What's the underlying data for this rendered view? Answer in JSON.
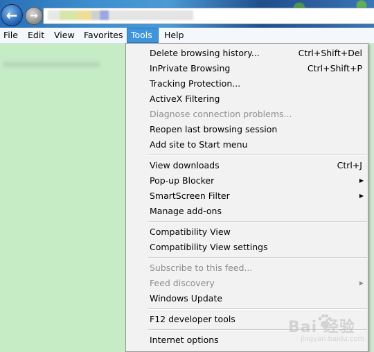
{
  "menubar": {
    "items": [
      "File",
      "Edit",
      "View",
      "Favorites",
      "Tools",
      "Help"
    ],
    "active": "Tools"
  },
  "tools_menu": {
    "groups": [
      [
        {
          "label": "Delete browsing history...",
          "shortcut": "Ctrl+Shift+Del"
        },
        {
          "label": "InPrivate Browsing",
          "shortcut": "Ctrl+Shift+P"
        },
        {
          "label": "Tracking Protection...",
          "shortcut": ""
        },
        {
          "label": "ActiveX Filtering",
          "shortcut": ""
        },
        {
          "label": "Diagnose connection problems...",
          "shortcut": "",
          "disabled": true
        },
        {
          "label": "Reopen last browsing session",
          "shortcut": ""
        },
        {
          "label": "Add site to Start menu",
          "shortcut": ""
        }
      ],
      [
        {
          "label": "View downloads",
          "shortcut": "Ctrl+J"
        },
        {
          "label": "Pop-up Blocker",
          "submenu": true
        },
        {
          "label": "SmartScreen Filter",
          "submenu": true
        },
        {
          "label": "Manage add-ons",
          "shortcut": ""
        }
      ],
      [
        {
          "label": "Compatibility View",
          "shortcut": ""
        },
        {
          "label": "Compatibility View settings",
          "shortcut": ""
        }
      ],
      [
        {
          "label": "Subscribe to this feed...",
          "shortcut": "",
          "disabled": true
        },
        {
          "label": "Feed discovery",
          "submenu": true,
          "disabled": true
        },
        {
          "label": "Windows Update",
          "shortcut": ""
        }
      ],
      [
        {
          "label": "F12 developer tools",
          "shortcut": ""
        }
      ],
      [
        {
          "label": "Internet options",
          "shortcut": ""
        }
      ]
    ]
  },
  "watermark": {
    "main": "Bai  经验",
    "sub": "jingyan.baidu.com"
  },
  "colors": {
    "menu_highlight": "#3f95dc",
    "page_background": "#c6ecc6",
    "disabled_text": "#8d8d8d"
  }
}
